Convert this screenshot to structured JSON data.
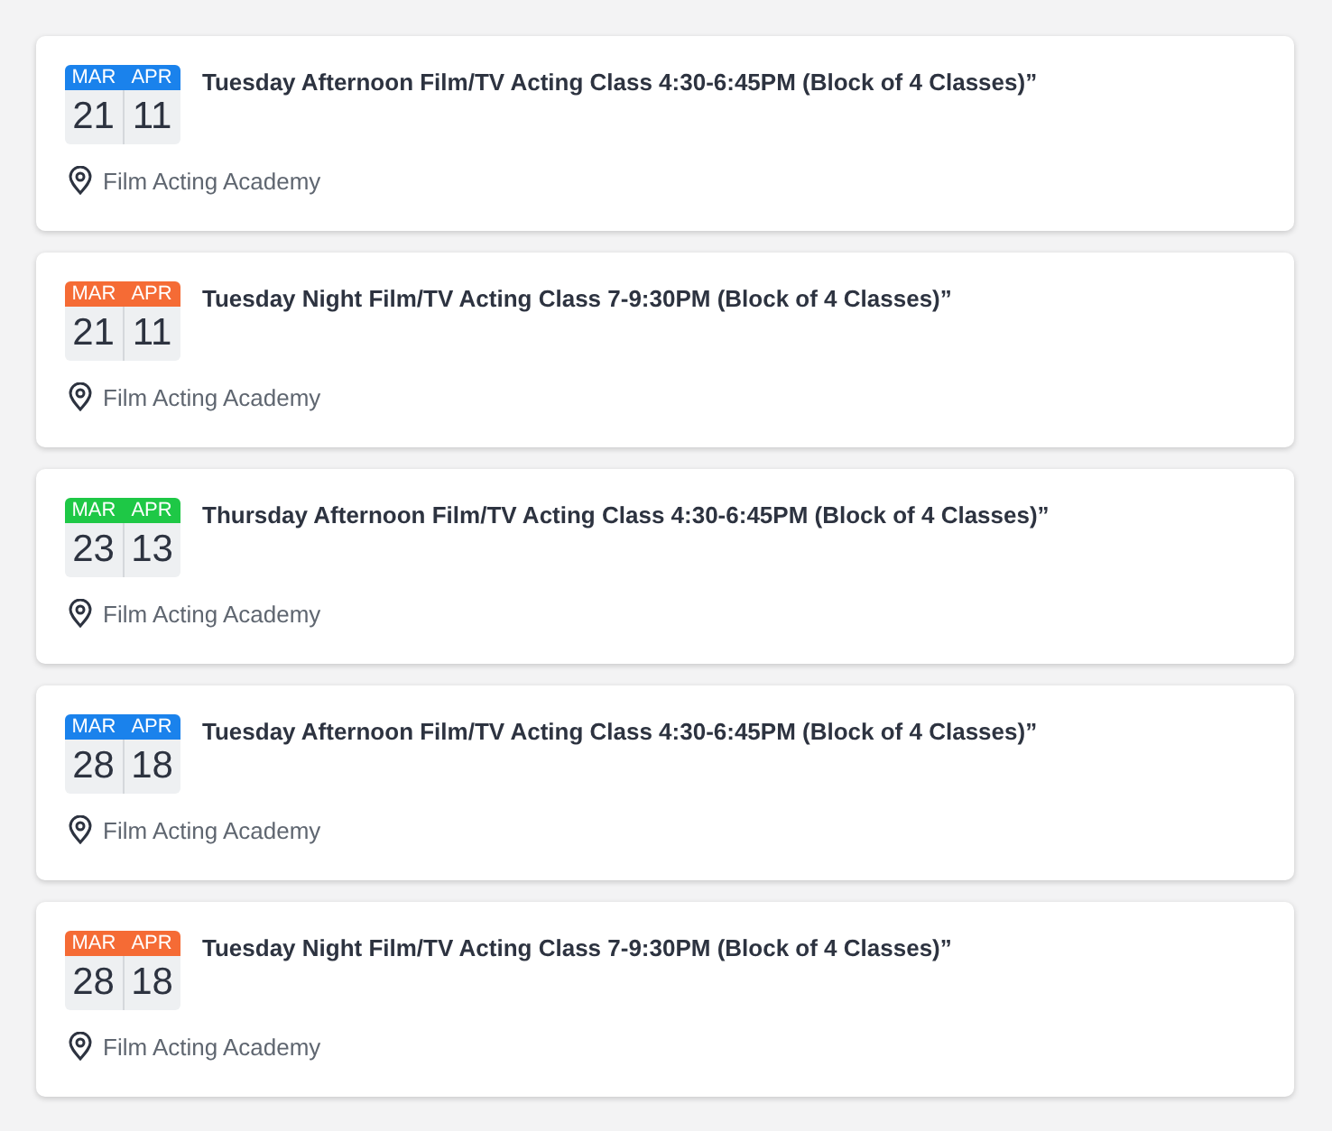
{
  "events": [
    {
      "color": "#1a82ec",
      "start": {
        "month": "MAR",
        "day": "21"
      },
      "end": {
        "month": "APR",
        "day": "11"
      },
      "title": "Tuesday Afternoon Film/TV Acting Class 4:30-6:45PM (Block of 4 Classes)”",
      "location": "Film Acting Academy"
    },
    {
      "color": "#f56b35",
      "start": {
        "month": "MAR",
        "day": "21"
      },
      "end": {
        "month": "APR",
        "day": "11"
      },
      "title": "Tuesday Night Film/TV Acting Class 7-9:30PM (Block of 4 Classes)”",
      "location": "Film Acting Academy"
    },
    {
      "color": "#1ec846",
      "start": {
        "month": "MAR",
        "day": "23"
      },
      "end": {
        "month": "APR",
        "day": "13"
      },
      "title": "Thursday Afternoon Film/TV Acting Class 4:30-6:45PM (Block of 4 Classes)”",
      "location": "Film Acting Academy"
    },
    {
      "color": "#1a82ec",
      "start": {
        "month": "MAR",
        "day": "28"
      },
      "end": {
        "month": "APR",
        "day": "18"
      },
      "title": "Tuesday Afternoon Film/TV Acting Class 4:30-6:45PM (Block of 4 Classes)”",
      "location": "Film Acting Academy"
    },
    {
      "color": "#f56b35",
      "start": {
        "month": "MAR",
        "day": "28"
      },
      "end": {
        "month": "APR",
        "day": "18"
      },
      "title": "Tuesday Night Film/TV Acting Class 7-9:30PM (Block of 4 Classes)”",
      "location": "Film Acting Academy"
    }
  ]
}
